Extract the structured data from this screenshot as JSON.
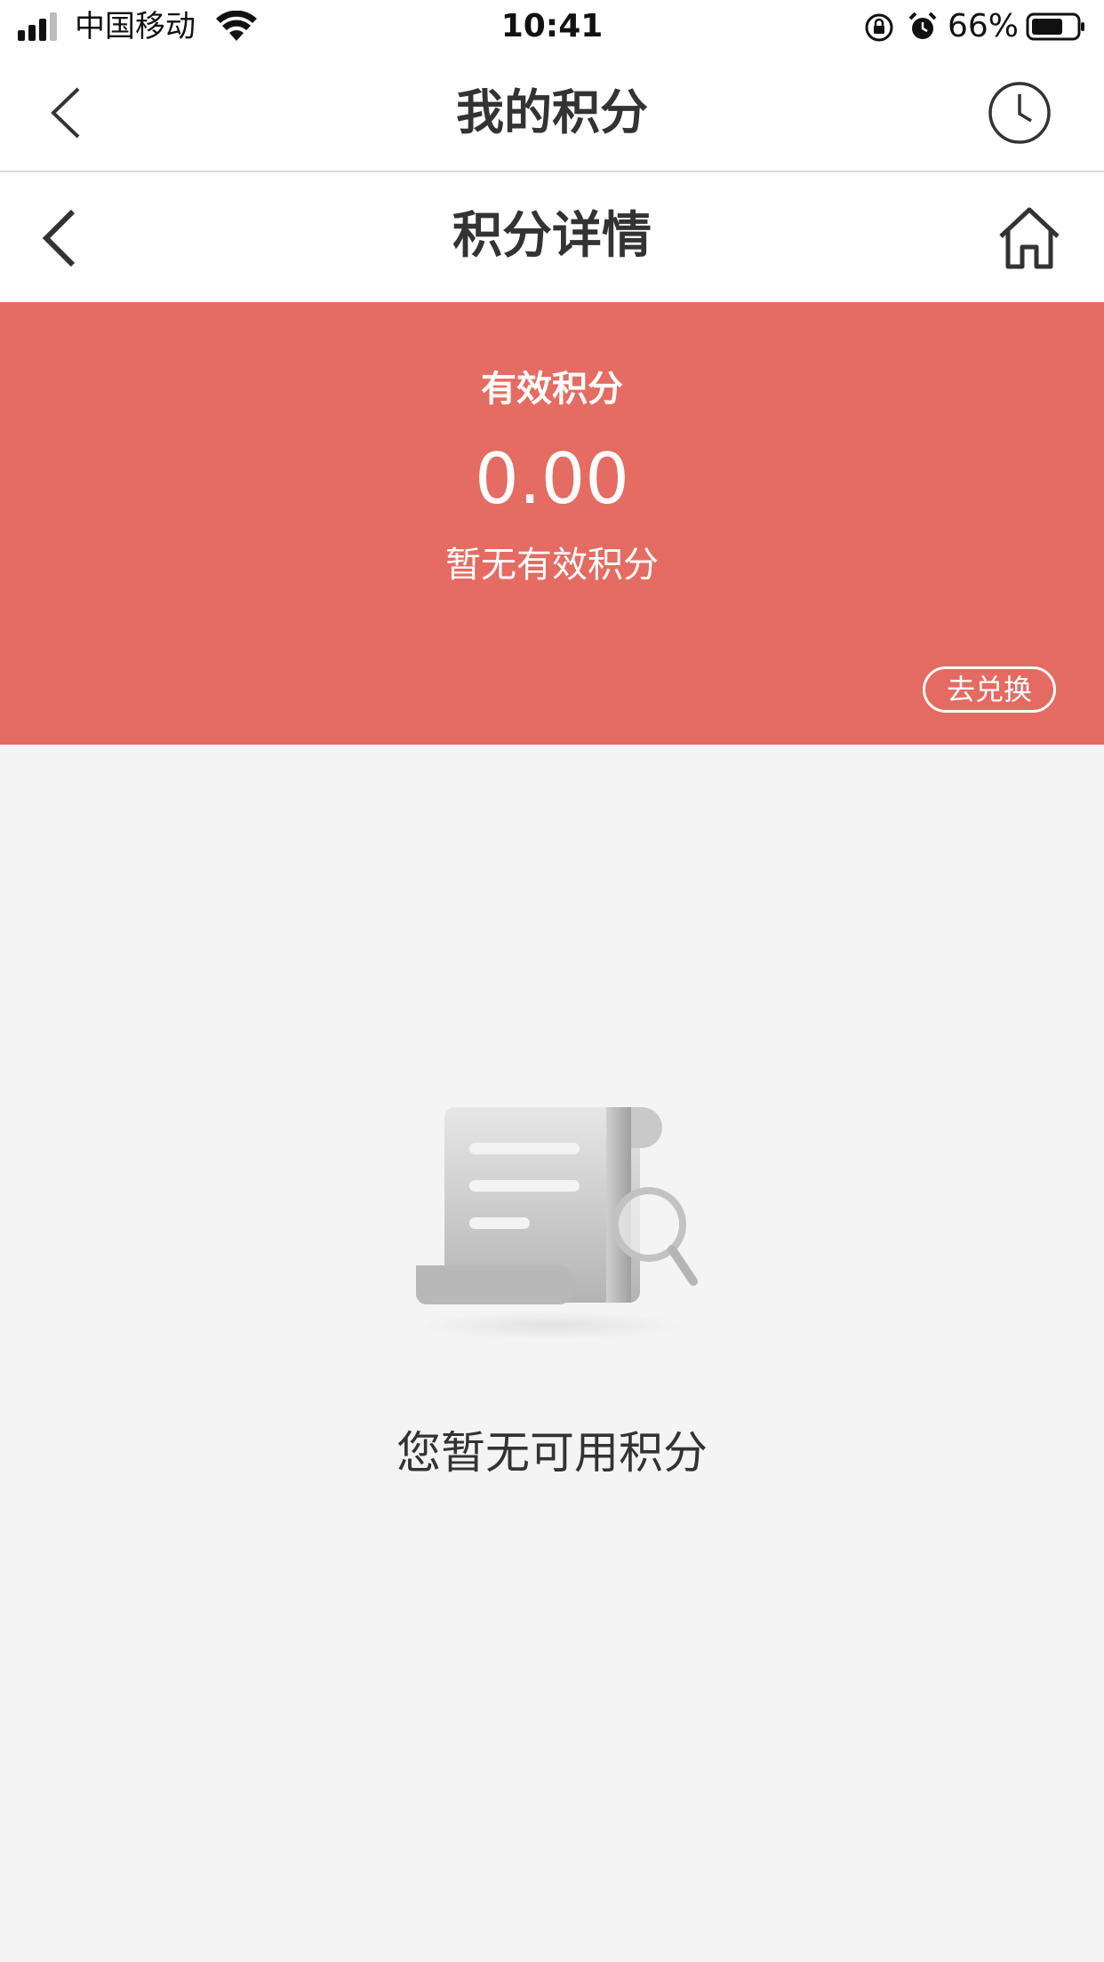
{
  "status_bar": {
    "carrier": "中国移动",
    "time": "10:41",
    "battery": "66%",
    "icons": [
      "signal-icon",
      "wifi-icon",
      "orientation-lock-icon",
      "alarm-icon",
      "battery-icon"
    ]
  },
  "app_header": {
    "title": "我的积分",
    "icons": [
      "back-arrow-icon",
      "history-clock-icon"
    ]
  },
  "page_header": {
    "title": "积分详情",
    "icons": [
      "back-arrow-icon",
      "home-icon"
    ]
  },
  "points_banner": {
    "label": "有效积分",
    "value": "0.00",
    "note": "暂无有效积分",
    "exchange_button": "去兑换",
    "colors": {
      "arc": "#e86f67",
      "base": "#d4624f"
    }
  },
  "empty_state": {
    "message": "您暂无可用积分",
    "icon": "empty-receipt-search-icon"
  },
  "colors": {
    "page_background": "#f4f4f4",
    "header_background": "#ffffff",
    "text_primary": "#333333"
  }
}
